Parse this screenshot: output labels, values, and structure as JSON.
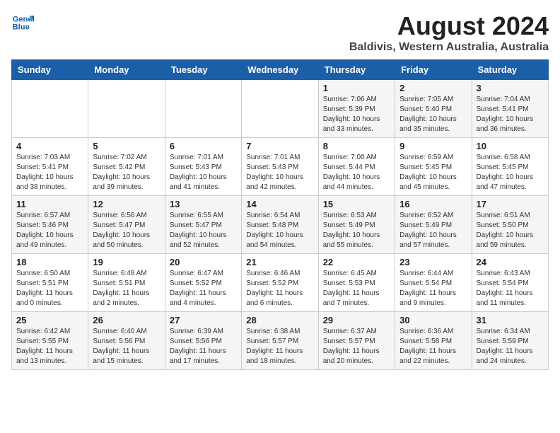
{
  "header": {
    "logo_line1": "General",
    "logo_line2": "Blue",
    "title": "August 2024",
    "subtitle": "Baldivis, Western Australia, Australia"
  },
  "days_of_week": [
    "Sunday",
    "Monday",
    "Tuesday",
    "Wednesday",
    "Thursday",
    "Friday",
    "Saturday"
  ],
  "weeks": [
    [
      {
        "day": "",
        "sunrise": "",
        "sunset": "",
        "daylight": ""
      },
      {
        "day": "",
        "sunrise": "",
        "sunset": "",
        "daylight": ""
      },
      {
        "day": "",
        "sunrise": "",
        "sunset": "",
        "daylight": ""
      },
      {
        "day": "",
        "sunrise": "",
        "sunset": "",
        "daylight": ""
      },
      {
        "day": "1",
        "sunrise": "Sunrise: 7:06 AM",
        "sunset": "Sunset: 5:39 PM",
        "daylight": "Daylight: 10 hours and 33 minutes."
      },
      {
        "day": "2",
        "sunrise": "Sunrise: 7:05 AM",
        "sunset": "Sunset: 5:40 PM",
        "daylight": "Daylight: 10 hours and 35 minutes."
      },
      {
        "day": "3",
        "sunrise": "Sunrise: 7:04 AM",
        "sunset": "Sunset: 5:41 PM",
        "daylight": "Daylight: 10 hours and 36 minutes."
      }
    ],
    [
      {
        "day": "4",
        "sunrise": "Sunrise: 7:03 AM",
        "sunset": "Sunset: 5:41 PM",
        "daylight": "Daylight: 10 hours and 38 minutes."
      },
      {
        "day": "5",
        "sunrise": "Sunrise: 7:02 AM",
        "sunset": "Sunset: 5:42 PM",
        "daylight": "Daylight: 10 hours and 39 minutes."
      },
      {
        "day": "6",
        "sunrise": "Sunrise: 7:01 AM",
        "sunset": "Sunset: 5:43 PM",
        "daylight": "Daylight: 10 hours and 41 minutes."
      },
      {
        "day": "7",
        "sunrise": "Sunrise: 7:01 AM",
        "sunset": "Sunset: 5:43 PM",
        "daylight": "Daylight: 10 hours and 42 minutes."
      },
      {
        "day": "8",
        "sunrise": "Sunrise: 7:00 AM",
        "sunset": "Sunset: 5:44 PM",
        "daylight": "Daylight: 10 hours and 44 minutes."
      },
      {
        "day": "9",
        "sunrise": "Sunrise: 6:59 AM",
        "sunset": "Sunset: 5:45 PM",
        "daylight": "Daylight: 10 hours and 45 minutes."
      },
      {
        "day": "10",
        "sunrise": "Sunrise: 6:58 AM",
        "sunset": "Sunset: 5:45 PM",
        "daylight": "Daylight: 10 hours and 47 minutes."
      }
    ],
    [
      {
        "day": "11",
        "sunrise": "Sunrise: 6:57 AM",
        "sunset": "Sunset: 5:46 PM",
        "daylight": "Daylight: 10 hours and 49 minutes."
      },
      {
        "day": "12",
        "sunrise": "Sunrise: 6:56 AM",
        "sunset": "Sunset: 5:47 PM",
        "daylight": "Daylight: 10 hours and 50 minutes."
      },
      {
        "day": "13",
        "sunrise": "Sunrise: 6:55 AM",
        "sunset": "Sunset: 5:47 PM",
        "daylight": "Daylight: 10 hours and 52 minutes."
      },
      {
        "day": "14",
        "sunrise": "Sunrise: 6:54 AM",
        "sunset": "Sunset: 5:48 PM",
        "daylight": "Daylight: 10 hours and 54 minutes."
      },
      {
        "day": "15",
        "sunrise": "Sunrise: 6:53 AM",
        "sunset": "Sunset: 5:49 PM",
        "daylight": "Daylight: 10 hours and 55 minutes."
      },
      {
        "day": "16",
        "sunrise": "Sunrise: 6:52 AM",
        "sunset": "Sunset: 5:49 PM",
        "daylight": "Daylight: 10 hours and 57 minutes."
      },
      {
        "day": "17",
        "sunrise": "Sunrise: 6:51 AM",
        "sunset": "Sunset: 5:50 PM",
        "daylight": "Daylight: 10 hours and 59 minutes."
      }
    ],
    [
      {
        "day": "18",
        "sunrise": "Sunrise: 6:50 AM",
        "sunset": "Sunset: 5:51 PM",
        "daylight": "Daylight: 11 hours and 0 minutes."
      },
      {
        "day": "19",
        "sunrise": "Sunrise: 6:48 AM",
        "sunset": "Sunset: 5:51 PM",
        "daylight": "Daylight: 11 hours and 2 minutes."
      },
      {
        "day": "20",
        "sunrise": "Sunrise: 6:47 AM",
        "sunset": "Sunset: 5:52 PM",
        "daylight": "Daylight: 11 hours and 4 minutes."
      },
      {
        "day": "21",
        "sunrise": "Sunrise: 6:46 AM",
        "sunset": "Sunset: 5:52 PM",
        "daylight": "Daylight: 11 hours and 6 minutes."
      },
      {
        "day": "22",
        "sunrise": "Sunrise: 6:45 AM",
        "sunset": "Sunset: 5:53 PM",
        "daylight": "Daylight: 11 hours and 7 minutes."
      },
      {
        "day": "23",
        "sunrise": "Sunrise: 6:44 AM",
        "sunset": "Sunset: 5:54 PM",
        "daylight": "Daylight: 11 hours and 9 minutes."
      },
      {
        "day": "24",
        "sunrise": "Sunrise: 6:43 AM",
        "sunset": "Sunset: 5:54 PM",
        "daylight": "Daylight: 11 hours and 11 minutes."
      }
    ],
    [
      {
        "day": "25",
        "sunrise": "Sunrise: 6:42 AM",
        "sunset": "Sunset: 5:55 PM",
        "daylight": "Daylight: 11 hours and 13 minutes."
      },
      {
        "day": "26",
        "sunrise": "Sunrise: 6:40 AM",
        "sunset": "Sunset: 5:56 PM",
        "daylight": "Daylight: 11 hours and 15 minutes."
      },
      {
        "day": "27",
        "sunrise": "Sunrise: 6:39 AM",
        "sunset": "Sunset: 5:56 PM",
        "daylight": "Daylight: 11 hours and 17 minutes."
      },
      {
        "day": "28",
        "sunrise": "Sunrise: 6:38 AM",
        "sunset": "Sunset: 5:57 PM",
        "daylight": "Daylight: 11 hours and 18 minutes."
      },
      {
        "day": "29",
        "sunrise": "Sunrise: 6:37 AM",
        "sunset": "Sunset: 5:57 PM",
        "daylight": "Daylight: 11 hours and 20 minutes."
      },
      {
        "day": "30",
        "sunrise": "Sunrise: 6:36 AM",
        "sunset": "Sunset: 5:58 PM",
        "daylight": "Daylight: 11 hours and 22 minutes."
      },
      {
        "day": "31",
        "sunrise": "Sunrise: 6:34 AM",
        "sunset": "Sunset: 5:59 PM",
        "daylight": "Daylight: 11 hours and 24 minutes."
      }
    ]
  ]
}
